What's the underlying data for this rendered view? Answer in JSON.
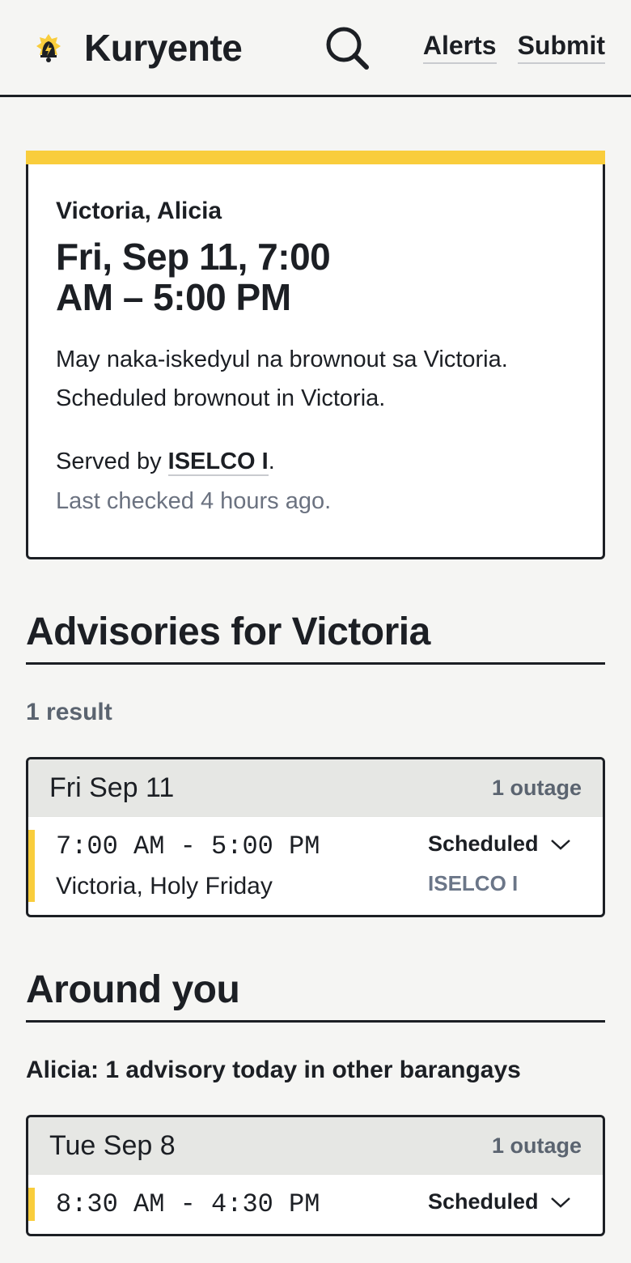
{
  "header": {
    "brand": "Kuryente",
    "nav_alerts": "Alerts",
    "nav_submit": "Submit",
    "accent": "#f9cd3c"
  },
  "hero": {
    "location": "Victoria, Alicia",
    "time": "Fri, Sep 11, 7:00 AM – 5:00 PM",
    "description": "May naka-iskedyul na brownout sa Victoria. Scheduled brownout in Victoria.",
    "served_prefix": "Served by",
    "provider": "ISELCO I",
    "served_suffix": ".",
    "last_checked": "Last checked 4 hours ago."
  },
  "advisories": {
    "title": "Advisories for Victoria",
    "result_count": "1 result",
    "groups": [
      {
        "date": "Fri Sep 11",
        "count": "1 outage",
        "rows": [
          {
            "time": "7:00 AM - 5:00 PM",
            "area": "Victoria, Holy Friday",
            "status": "Scheduled",
            "provider": "ISELCO I"
          }
        ]
      }
    ]
  },
  "around": {
    "title": "Around you",
    "subtitle": "Alicia: 1 advisory today in other barangays",
    "groups": [
      {
        "date": "Tue Sep 8",
        "count": "1 outage",
        "rows": [
          {
            "time": "8:30 AM - 4:30 PM",
            "status": "Scheduled"
          }
        ]
      }
    ]
  }
}
